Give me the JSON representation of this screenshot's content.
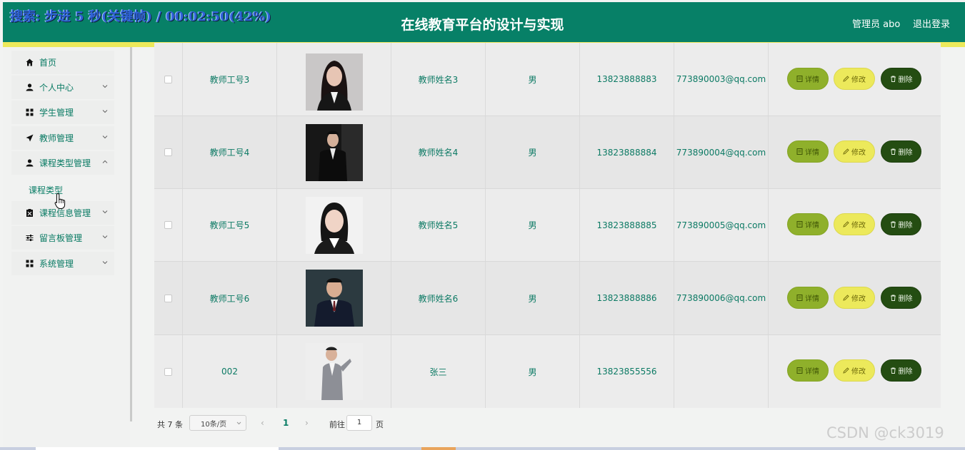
{
  "overlay_text": "搜索: 步进 5 秒(关键帧) / 00:02:50(42%)",
  "header": {
    "title": "在线教育平台的设计与实现",
    "user": "管理员 abo",
    "logout": "退出登录"
  },
  "sidebar": {
    "items": [
      {
        "label": "首页",
        "icon": "home-icon"
      },
      {
        "label": "个人中心",
        "icon": "person-icon"
      },
      {
        "label": "学生管理",
        "icon": "grid-icon"
      },
      {
        "label": "教师管理",
        "icon": "send-icon"
      },
      {
        "label": "课程类型管理",
        "icon": "person-icon"
      },
      {
        "label": "课程信息管理",
        "icon": "clipboard-icon"
      },
      {
        "label": "留言板管理",
        "icon": "sliders-icon"
      },
      {
        "label": "系统管理",
        "icon": "grid-icon"
      }
    ],
    "sub_item": "课程类型"
  },
  "table": {
    "rows": [
      {
        "no": "教师工号3",
        "name": "教师姓名3",
        "sex": "男",
        "phone": "13823888883",
        "email": "773890003@qq.com"
      },
      {
        "no": "教师工号4",
        "name": "教师姓名4",
        "sex": "男",
        "phone": "13823888884",
        "email": "773890004@qq.com"
      },
      {
        "no": "教师工号5",
        "name": "教师姓名5",
        "sex": "男",
        "phone": "13823888885",
        "email": "773890005@qq.com"
      },
      {
        "no": "教师工号6",
        "name": "教师姓名6",
        "sex": "男",
        "phone": "13823888886",
        "email": "773890006@qq.com"
      },
      {
        "no": "002",
        "name": "张三",
        "sex": "男",
        "phone": "13823855556",
        "email": ""
      }
    ],
    "buttons": {
      "detail": "详情",
      "edit": "修改",
      "delete": "删除"
    }
  },
  "pagination": {
    "total": "共 7 条",
    "page_size": "10条/页",
    "current": "1",
    "goto_label": "前往",
    "goto_value": "1",
    "page_label": "页"
  },
  "watermark": "CSDN @ck3019",
  "colors": {
    "header": "#078067",
    "accent_yellow": "#ece95b",
    "detail": "#8fb02b",
    "delete": "#244d12"
  }
}
